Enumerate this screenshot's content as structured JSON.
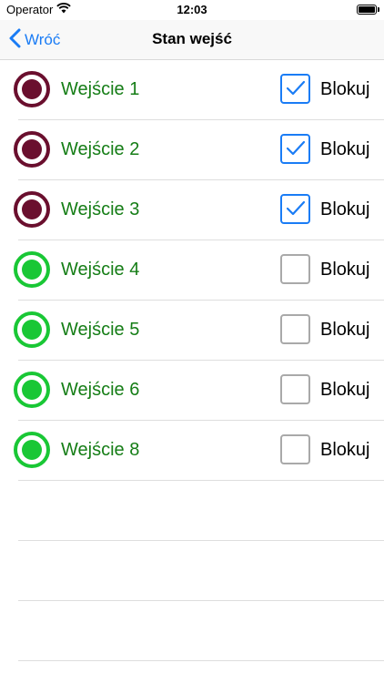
{
  "status_bar": {
    "carrier": "Operator",
    "time": "12:03"
  },
  "nav": {
    "back_label": "Wróć",
    "title": "Stan wejść"
  },
  "inputs": [
    {
      "label": "Wejście 1",
      "blocked": true,
      "checkbox_label": "Blokuj"
    },
    {
      "label": "Wejście 2",
      "blocked": true,
      "checkbox_label": "Blokuj"
    },
    {
      "label": "Wejście 3",
      "blocked": true,
      "checkbox_label": "Blokuj"
    },
    {
      "label": "Wejście 4",
      "blocked": false,
      "checkbox_label": "Blokuj"
    },
    {
      "label": "Wejście 5",
      "blocked": false,
      "checkbox_label": "Blokuj"
    },
    {
      "label": "Wejście 6",
      "blocked": false,
      "checkbox_label": "Blokuj"
    },
    {
      "label": "Wejście 8",
      "blocked": false,
      "checkbox_label": "Blokuj"
    }
  ],
  "colors": {
    "accent": "#1a7cf5",
    "blocked_indicator": "#6a0f2e",
    "active_indicator": "#19c735",
    "label_green": "#157d16"
  },
  "icons": {
    "indicator": "status-circle-icon",
    "checkmark": "checkmark-icon",
    "back": "chevron-left-icon"
  }
}
